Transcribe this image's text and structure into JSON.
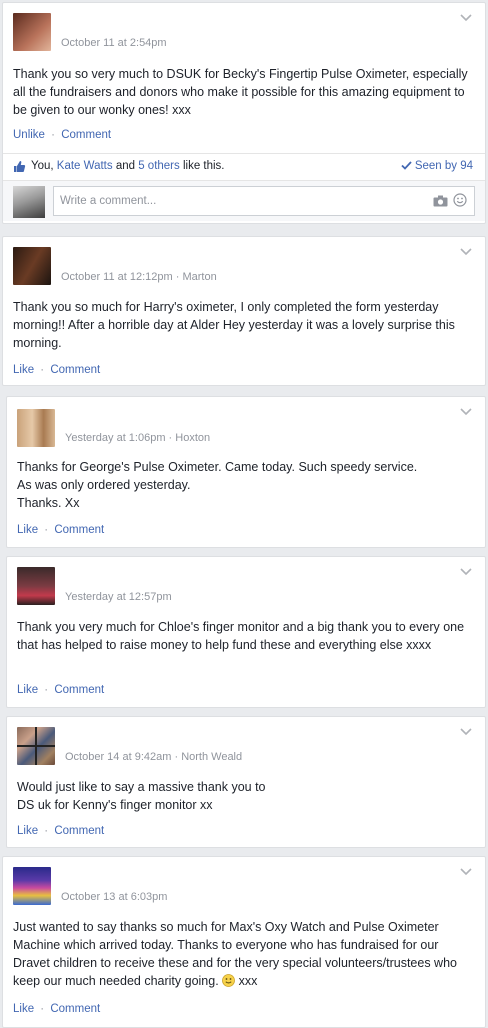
{
  "posts": [
    {
      "timestamp": "October 11 at 2:54pm",
      "location": "",
      "text": "Thank you so very much to DSUK for Becky's Fingertip Pulse Oximeter, especially all the fundraisers and donors who make it possible for this amazing equipment to be given to our wonky ones! xxx",
      "like_label": "Unlike",
      "comment_label": "Comment",
      "likes": {
        "you": "You, ",
        "name": "Kate Watts",
        "and": " and ",
        "others": "5 others",
        "suffix": " like this."
      },
      "seen": "Seen by 94",
      "comment_placeholder": "Write a comment..."
    },
    {
      "timestamp": "October 11 at 12:12pm",
      "location": "Marton",
      "text": "Thank you so much for Harry's oximeter, I only completed the form yesterday morning!! After a horrible day at Alder Hey yesterday it was a lovely surprise this morning.",
      "like_label": "Like",
      "comment_label": "Comment"
    },
    {
      "timestamp": "Yesterday at 1:06pm",
      "location": "Hoxton",
      "text_lines": [
        "Thanks for George's Pulse Oximeter. Came today. Such speedy service.",
        "As was only ordered yesterday.",
        "Thanks. Xx"
      ],
      "like_label": "Like",
      "comment_label": "Comment"
    },
    {
      "timestamp": "Yesterday at 12:57pm",
      "location": "",
      "text": "Thank you very much for Chloe's finger monitor and a big thank you to every one that has helped to raise money to help fund these and everything else xxxx",
      "like_label": "Like",
      "comment_label": "Comment"
    },
    {
      "timestamp": "October 14 at 9:42am",
      "location": "North Weald",
      "text_lines": [
        "Would just like to say a massive thank you to",
        "DS uk for Kenny's finger monitor xx"
      ],
      "like_label": "Like",
      "comment_label": "Comment"
    },
    {
      "timestamp": "October 13 at 6:03pm",
      "location": "",
      "text": "Just wanted to say thanks so much for Max's Oxy Watch and Pulse Oximeter Machine which arrived today. Thanks to everyone who has fundraised for our Dravet children to receive these and for the very special volunteers/trustees who keep our much needed charity going.",
      "text_suffix": " xxx",
      "like_label": "Like",
      "comment_label": "Comment"
    }
  ],
  "separator": " · ",
  "colors": {
    "link": "#4267b2",
    "meta": "#90949c",
    "background": "#e9ebee"
  }
}
